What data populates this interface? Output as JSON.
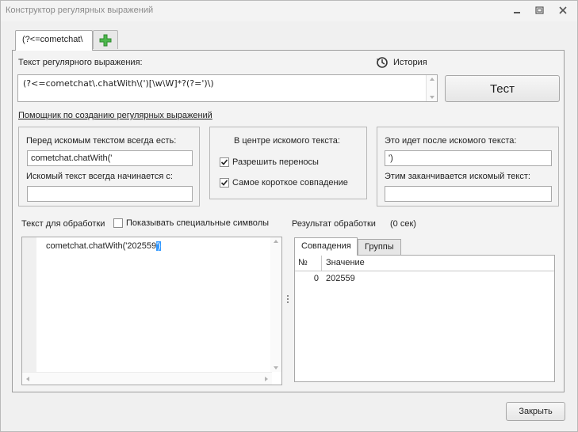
{
  "window": {
    "title": "Конструктор регулярных выражений"
  },
  "tabs": {
    "active_label": "(?<=cometchat\\"
  },
  "regex": {
    "label": "Текст регулярного выражения:",
    "value": "(?<=cometchat\\.chatWith\\(')[\\w\\W]*?(?=')\\)",
    "history_label": "История",
    "test_label": "Тест"
  },
  "helper": {
    "link_label": "Помощник по созданию регулярных выражений",
    "before": {
      "label": "Перед искомым текстом всегда есть:",
      "value": "cometchat.chatWith('",
      "starts_label": "Искомый текст всегда начинается с:",
      "starts_value": ""
    },
    "center": {
      "label": "В центре искомого текста:",
      "allow_breaks_label": "Разрешить переносы",
      "allow_breaks_checked": true,
      "shortest_label": "Самое короткое совпадение",
      "shortest_checked": true
    },
    "after": {
      "label": "Это идет после искомого текста:",
      "value": "')",
      "ends_label": "Этим заканчивается искомый текст:",
      "ends_value": ""
    }
  },
  "input": {
    "label": "Текст для обработки",
    "show_special_label": "Показывать специальные символы",
    "show_special_checked": false,
    "text_prefix": "cometchat.chatWith('202559",
    "text_selected": "')"
  },
  "result": {
    "label": "Результат обработки",
    "time": "(0 сек)",
    "tabs": [
      "Совпадения",
      "Группы"
    ],
    "columns": [
      "№",
      "Значение"
    ],
    "rows": [
      {
        "index": "0",
        "value": "202559"
      }
    ]
  },
  "footer": {
    "close_label": "Закрыть"
  },
  "colors": {
    "accent": "#3399ff",
    "add_icon": "#4cb84c"
  }
}
